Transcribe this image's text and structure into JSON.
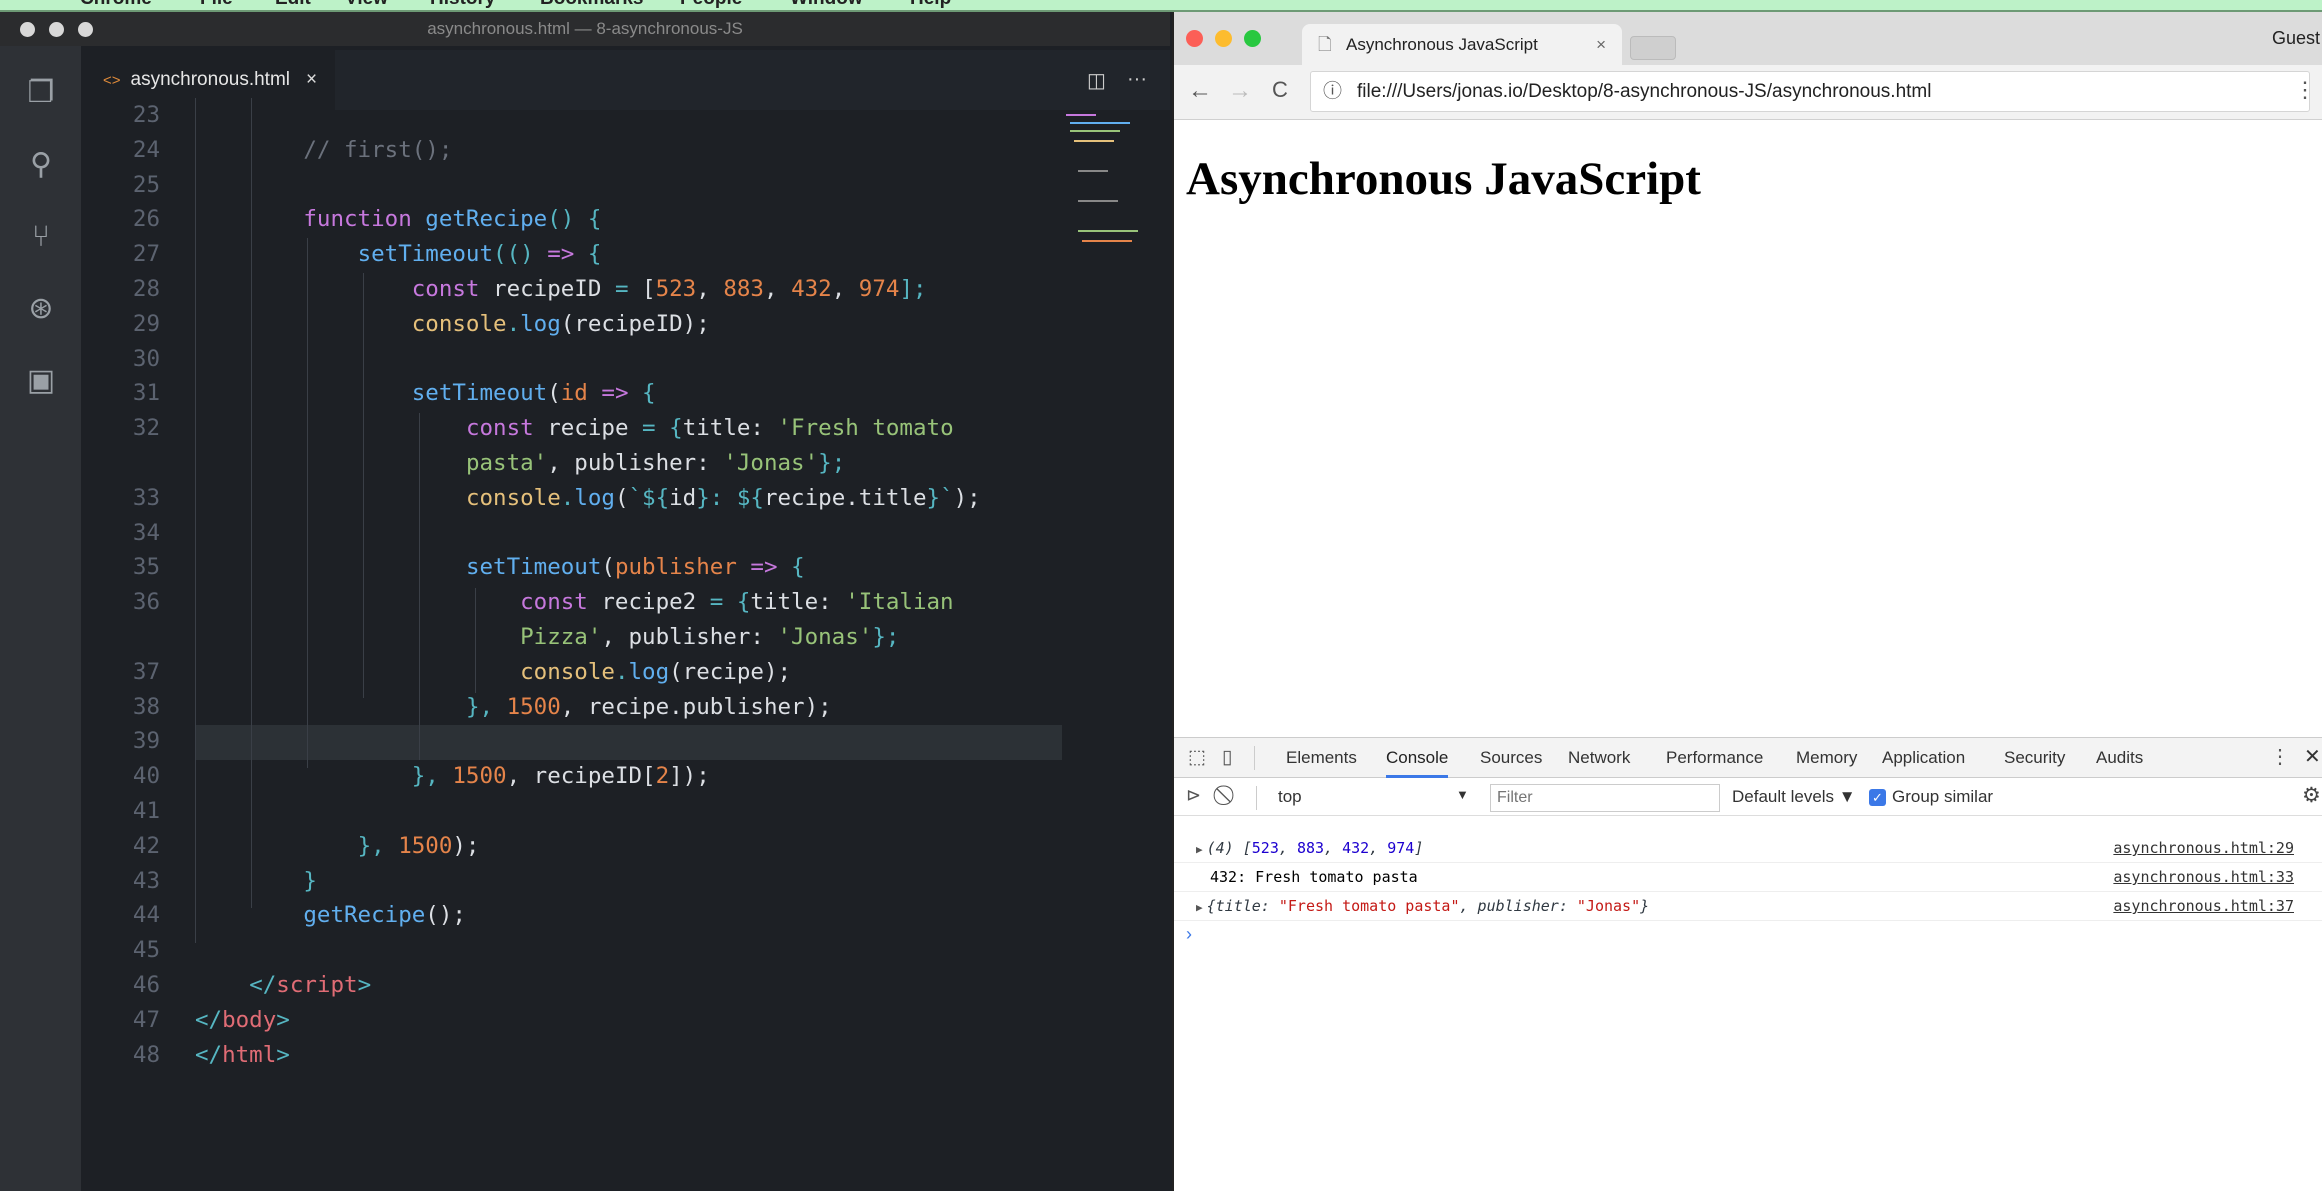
{
  "menubar": {
    "items": [
      "Chrome",
      "File",
      "Edit",
      "View",
      "History",
      "Bookmarks",
      "People",
      "Window",
      "Help"
    ]
  },
  "vscode": {
    "window_title": "asynchronous.html — 8-asynchronous-JS",
    "tab": {
      "label": "asynchronous.html",
      "close": "×",
      "icon": "html-file-icon"
    },
    "activity": [
      "files-icon",
      "search-icon",
      "source-control-icon",
      "debug-icon",
      "extensions-icon"
    ],
    "actions": {
      "split": "◫",
      "more": "···"
    },
    "current_line": 39,
    "lines": [
      {
        "n": "23",
        "indent": 0,
        "t": []
      },
      {
        "n": "24",
        "indent": 8,
        "t": [
          [
            "// first();",
            "cm"
          ]
        ]
      },
      {
        "n": "25",
        "indent": 0,
        "t": []
      },
      {
        "n": "26",
        "indent": 8,
        "t": [
          [
            "function ",
            "kw"
          ],
          [
            "getRecipe",
            "fn"
          ],
          [
            "() {",
            "pun"
          ]
        ]
      },
      {
        "n": "27",
        "indent": 12,
        "t": [
          [
            "setTimeout",
            "fn"
          ],
          [
            "(() ",
            "pun"
          ],
          [
            "=> ",
            "kw"
          ],
          [
            "{",
            "pun"
          ]
        ]
      },
      {
        "n": "28",
        "indent": 16,
        "t": [
          [
            "const ",
            "kw"
          ],
          [
            "recipeID ",
            "plain"
          ],
          [
            "= ",
            "pun"
          ],
          [
            "[",
            "plain"
          ],
          [
            "523",
            "num"
          ],
          [
            ", ",
            "plain"
          ],
          [
            "883",
            "num"
          ],
          [
            ", ",
            "plain"
          ],
          [
            "432",
            "num"
          ],
          [
            ", ",
            "plain"
          ],
          [
            "974",
            "num"
          ],
          [
            "];",
            "pun"
          ]
        ]
      },
      {
        "n": "29",
        "indent": 16,
        "t": [
          [
            "console",
            "obj"
          ],
          [
            ".",
            "pun"
          ],
          [
            "log",
            "fn"
          ],
          [
            "(recipeID);",
            "plain"
          ]
        ]
      },
      {
        "n": "30",
        "indent": 0,
        "t": []
      },
      {
        "n": "31",
        "indent": 16,
        "t": [
          [
            "setTimeout",
            "fn"
          ],
          [
            "(",
            "plain"
          ],
          [
            "id ",
            "par"
          ],
          [
            "=> ",
            "kw"
          ],
          [
            "{",
            "pun"
          ]
        ]
      },
      {
        "n": "32",
        "indent": 20,
        "t": [
          [
            "const ",
            "kw"
          ],
          [
            "recipe ",
            "plain"
          ],
          [
            "= ",
            "pun"
          ],
          [
            "{",
            "pun"
          ],
          [
            "title: ",
            "plain"
          ],
          [
            "'Fresh tomato",
            "str"
          ]
        ]
      },
      {
        "n": "",
        "indent": 20,
        "t": [
          [
            "pasta'",
            "str"
          ],
          [
            ", publisher: ",
            "plain"
          ],
          [
            "'Jonas'",
            "str"
          ],
          [
            "};",
            "pun"
          ]
        ]
      },
      {
        "n": "33",
        "indent": 20,
        "t": [
          [
            "console",
            "obj"
          ],
          [
            ".",
            "pun"
          ],
          [
            "log",
            "fn"
          ],
          [
            "(",
            "plain"
          ],
          [
            "`${",
            "pun"
          ],
          [
            "id",
            "plain"
          ],
          [
            "}: ${",
            "pun"
          ],
          [
            "recipe.title",
            "plain"
          ],
          [
            "}`",
            "pun"
          ],
          [
            ");",
            "plain"
          ]
        ]
      },
      {
        "n": "34",
        "indent": 0,
        "t": []
      },
      {
        "n": "35",
        "indent": 20,
        "t": [
          [
            "setTimeout",
            "fn"
          ],
          [
            "(",
            "plain"
          ],
          [
            "publisher ",
            "par"
          ],
          [
            "=> ",
            "kw"
          ],
          [
            "{",
            "pun"
          ]
        ]
      },
      {
        "n": "36",
        "indent": 24,
        "t": [
          [
            "const ",
            "kw"
          ],
          [
            "recipe2 ",
            "plain"
          ],
          [
            "= ",
            "pun"
          ],
          [
            "{",
            "pun"
          ],
          [
            "title: ",
            "plain"
          ],
          [
            "'Italian",
            "str"
          ]
        ]
      },
      {
        "n": "",
        "indent": 24,
        "t": [
          [
            "Pizza'",
            "str"
          ],
          [
            ", publisher: ",
            "plain"
          ],
          [
            "'Jonas'",
            "str"
          ],
          [
            "};",
            "pun"
          ]
        ]
      },
      {
        "n": "37",
        "indent": 24,
        "t": [
          [
            "console",
            "obj"
          ],
          [
            ".",
            "pun"
          ],
          [
            "log",
            "fn"
          ],
          [
            "(recipe);",
            "plain"
          ]
        ]
      },
      {
        "n": "38",
        "indent": 20,
        "t": [
          [
            "}, ",
            "pun"
          ],
          [
            "1500",
            "num"
          ],
          [
            ", recipe.publisher);",
            "plain"
          ]
        ]
      },
      {
        "n": "39",
        "indent": 0,
        "t": []
      },
      {
        "n": "40",
        "indent": 16,
        "t": [
          [
            "}, ",
            "pun"
          ],
          [
            "1500",
            "num"
          ],
          [
            ", recipeID[",
            "plain"
          ],
          [
            "2",
            "num"
          ],
          [
            "]);",
            "plain"
          ]
        ]
      },
      {
        "n": "41",
        "indent": 0,
        "t": []
      },
      {
        "n": "42",
        "indent": 12,
        "t": [
          [
            "}, ",
            "pun"
          ],
          [
            "1500",
            "num"
          ],
          [
            ");",
            "plain"
          ]
        ]
      },
      {
        "n": "43",
        "indent": 8,
        "t": [
          [
            "}",
            "pun"
          ]
        ]
      },
      {
        "n": "44",
        "indent": 8,
        "t": [
          [
            "getRecipe",
            "fn"
          ],
          [
            "();",
            "plain"
          ]
        ]
      },
      {
        "n": "45",
        "indent": 0,
        "t": []
      },
      {
        "n": "46",
        "indent": 4,
        "t": [
          [
            "</",
            "pun"
          ],
          [
            "script",
            "tag"
          ],
          [
            ">",
            "pun"
          ]
        ]
      },
      {
        "n": "47",
        "indent": 0,
        "t": [
          [
            "</",
            "pun"
          ],
          [
            "body",
            "tag"
          ],
          [
            ">",
            "pun"
          ]
        ]
      },
      {
        "n": "48",
        "indent": 0,
        "t": [
          [
            "</",
            "pun"
          ],
          [
            "html",
            "tag"
          ],
          [
            ">",
            "pun"
          ]
        ]
      }
    ]
  },
  "browser": {
    "tab_title": "Asynchronous JavaScript",
    "tab_close": "×",
    "profile": "Guest",
    "url": "file:///Users/jonas.io/Desktop/8-asynchronous-JS/asynchronous.html",
    "nav": {
      "back": "←",
      "forward": "→",
      "reload": "C",
      "menu": "⋮",
      "info": "ⓘ"
    },
    "page_heading": "Asynchronous JavaScript",
    "devtools": {
      "tabs": [
        "Elements",
        "Console",
        "Sources",
        "Network",
        "Performance",
        "Memory",
        "Application",
        "Security",
        "Audits"
      ],
      "active_tab": "Console",
      "context": "top",
      "filter_placeholder": "Filter",
      "levels": "Default levels ▼",
      "group_similar": "Group similar",
      "group_similar_checked": true,
      "messages": [
        {
          "expand": "▶",
          "parts": [
            [
              "(4) ",
              "it"
            ],
            [
              "[",
              "it"
            ],
            [
              "523",
              "num"
            ],
            [
              ", ",
              "it"
            ],
            [
              "883",
              "num"
            ],
            [
              ", ",
              "it"
            ],
            [
              "432",
              "num"
            ],
            [
              ", ",
              "it"
            ],
            [
              "974",
              "num"
            ],
            [
              "]",
              "it"
            ]
          ],
          "source": "asynchronous.html:29"
        },
        {
          "expand": "",
          "parts": [
            [
              "432: Fresh tomato pasta",
              ""
            ]
          ],
          "source": "asynchronous.html:33"
        },
        {
          "expand": "▶",
          "parts": [
            [
              "{title: ",
              "it"
            ],
            [
              "\"Fresh tomato pasta\"",
              "str"
            ],
            [
              ", publisher: ",
              "it"
            ],
            [
              "\"Jonas\"",
              "str"
            ],
            [
              "}",
              "it"
            ]
          ],
          "source": "asynchronous.html:37"
        }
      ],
      "prompt": "›"
    }
  }
}
